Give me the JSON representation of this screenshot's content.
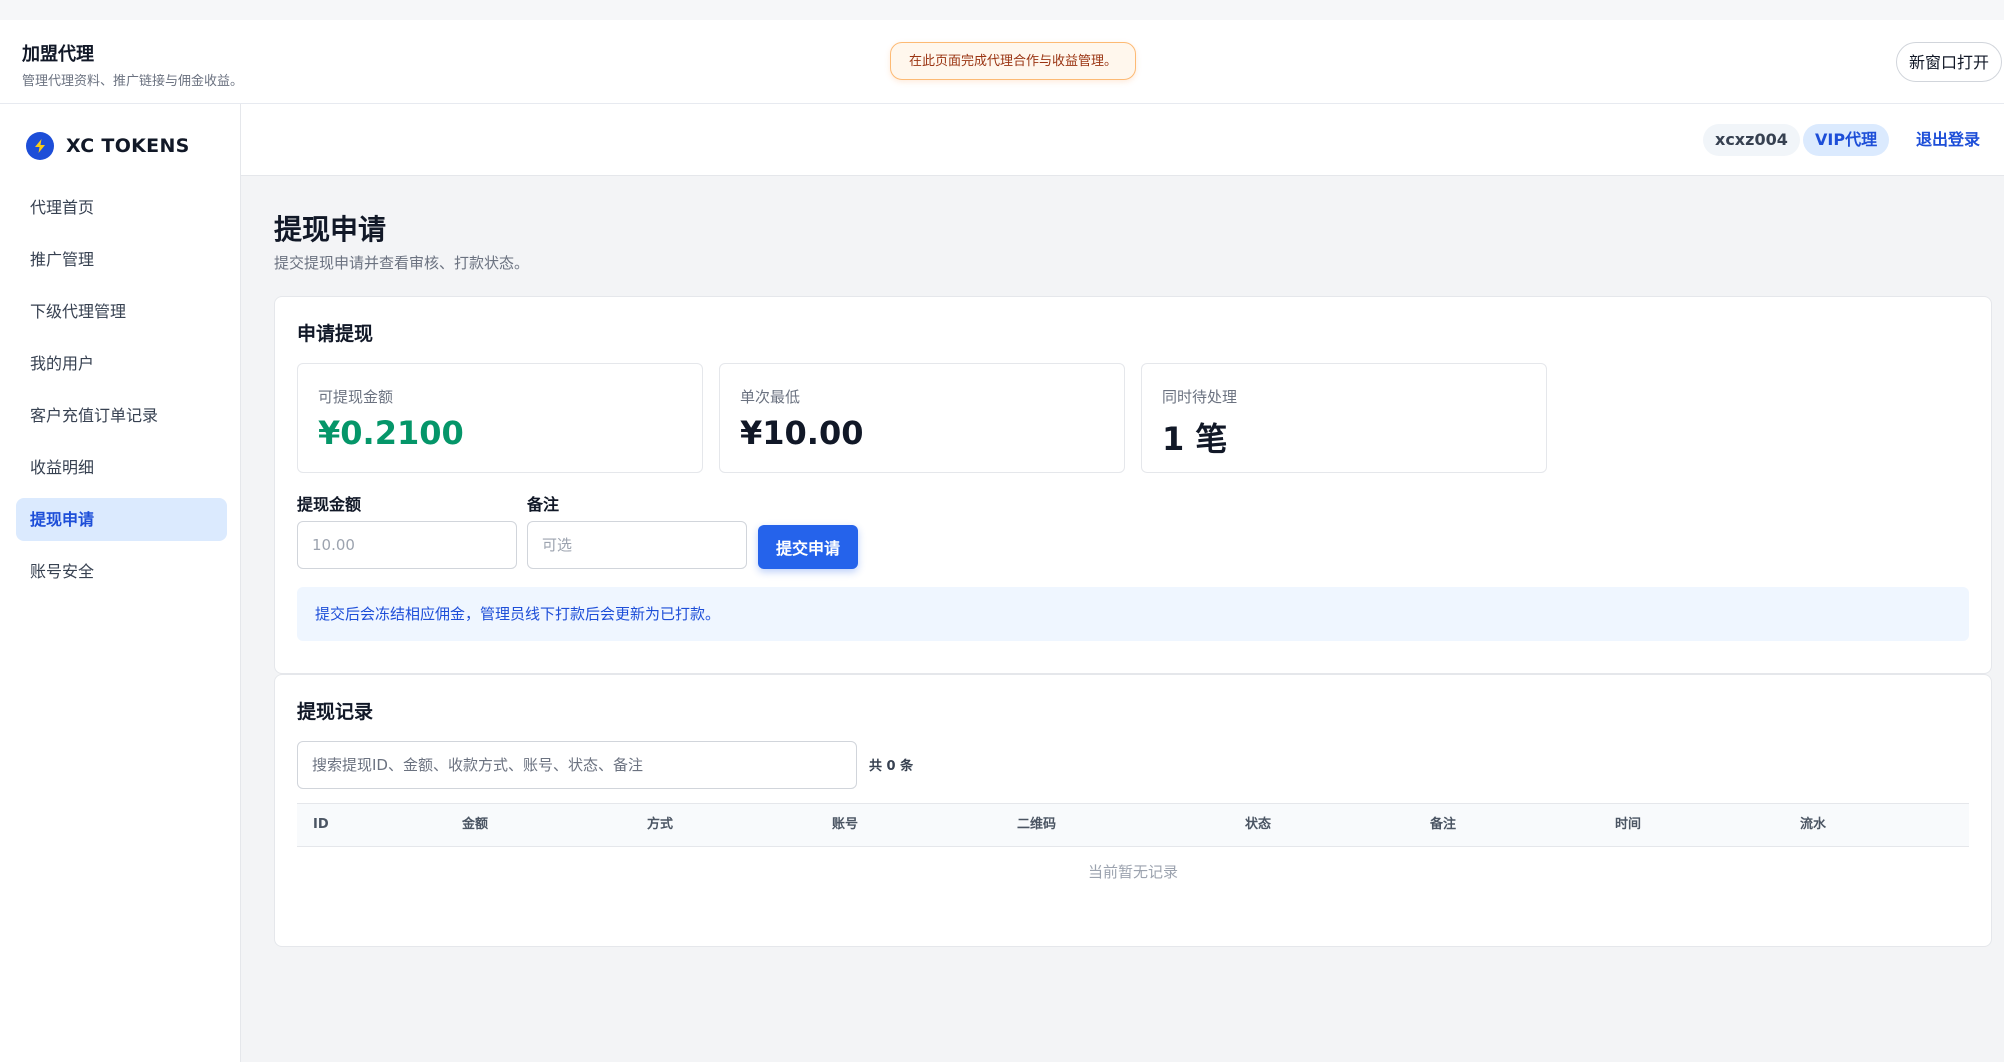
{
  "header": {
    "title": "加盟代理",
    "subtitle": "管理代理资料、推广链接与佣金收益。",
    "notice": "在此页面完成代理合作与收益管理。",
    "open_new_window": "新窗口打开"
  },
  "sidebar": {
    "brand": "XC TOKENS",
    "items": [
      {
        "label": "代理首页"
      },
      {
        "label": "推广管理"
      },
      {
        "label": "下级代理管理"
      },
      {
        "label": "我的用户"
      },
      {
        "label": "客户充值订单记录"
      },
      {
        "label": "收益明细"
      },
      {
        "label": "提现申请"
      },
      {
        "label": "账号安全"
      }
    ],
    "active_index": 6
  },
  "userbar": {
    "username": "xcxz004",
    "level": "VIP代理",
    "logout": "退出登录"
  },
  "page": {
    "title": "提现申请",
    "subtitle": "提交提现申请并查看审核、打款状态。"
  },
  "apply": {
    "title": "申请提现",
    "stats": [
      {
        "label": "可提现金额",
        "value": "¥0.2100"
      },
      {
        "label": "单次最低",
        "value": "¥10.00"
      },
      {
        "label": "同时待处理",
        "value": "1 笔"
      }
    ],
    "amount_label": "提现金额",
    "amount_placeholder": "10.00",
    "remark_label": "备注",
    "remark_placeholder": "可选",
    "submit": "提交申请",
    "info": "提交后会冻结相应佣金，管理员线下打款后会更新为已打款。"
  },
  "records": {
    "title": "提现记录",
    "search_placeholder": "搜索提现ID、金额、收款方式、账号、状态、备注",
    "count": "共 0 条",
    "columns": [
      "ID",
      "金额",
      "方式",
      "账号",
      "二维码",
      "状态",
      "备注",
      "时间",
      "流水"
    ],
    "empty": "当前暂无记录"
  },
  "colors": {
    "accent": "#2563eb",
    "available_amount": "#059669",
    "notice_border": "#fdba74"
  }
}
